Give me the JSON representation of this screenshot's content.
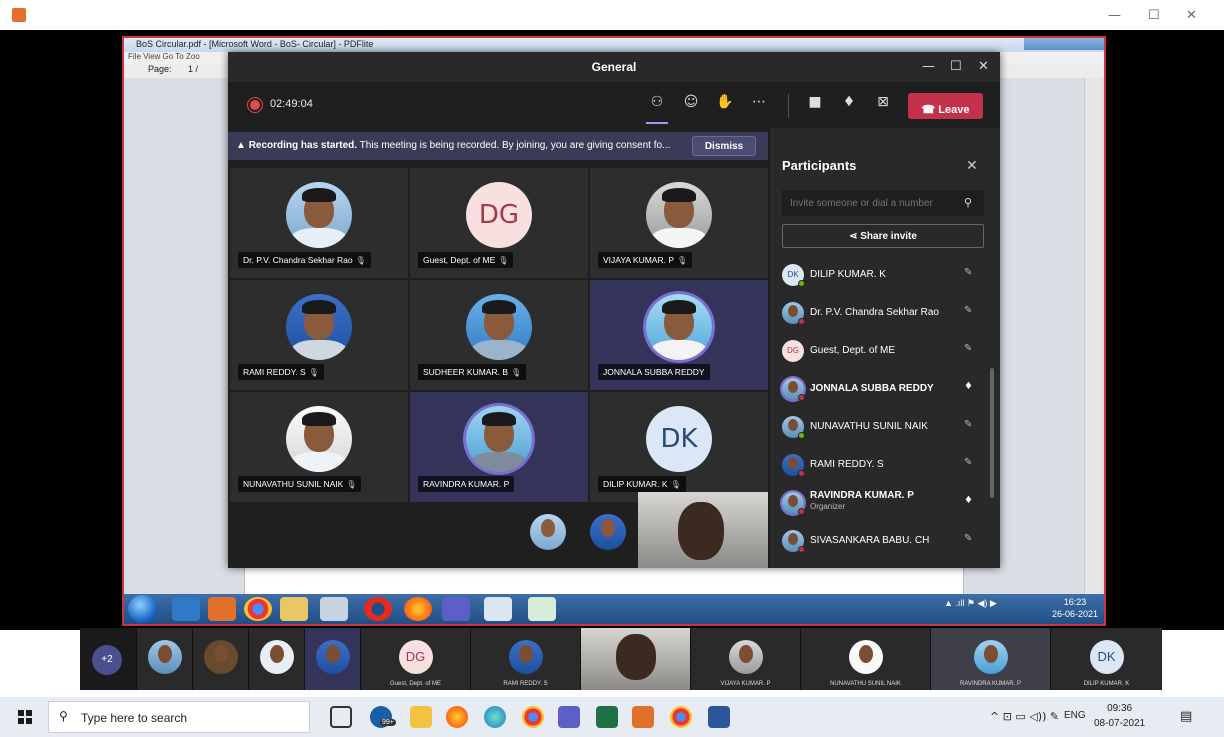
{
  "outer_window": {
    "minimize": "—",
    "maximize": "☐",
    "close": "✕"
  },
  "pdf": {
    "title": "BoS Circular.pdf - [Microsoft Word - BoS- Circular] - PDFlite",
    "menu": "File   View   Go To   Zoo",
    "page_label": "Page:",
    "page_value": "1 /"
  },
  "win7": {
    "tray": "▲ .ıll  ⚑  ◀)  ▶",
    "time": "16:23",
    "date": "26-06-2021"
  },
  "teams": {
    "title": "General",
    "timer": "02:49:04",
    "leave_label": "Leave",
    "banner_bold": "Recording has started.",
    "banner_text": "This meeting is being recorded. By joining, you are giving consent fo...",
    "dismiss_label": "Dismiss",
    "tiles": [
      {
        "name": "Dr. P.V. Chandra Sekhar Rao"
      },
      {
        "name": "Guest, Dept. of ME",
        "initials": "DG"
      },
      {
        "name": "VIJAYA KUMAR. P"
      },
      {
        "name": "RAMI REDDY. S"
      },
      {
        "name": "SUDHEER KUMAR. B"
      },
      {
        "name": "JONNALA SUBBA REDDY"
      },
      {
        "name": "NUNAVATHU SUNIL NAIK"
      },
      {
        "name": "RAVINDRA KUMAR. P"
      },
      {
        "name": "DILIP KUMAR. K",
        "initials": "DK"
      }
    ],
    "panel": {
      "title": "Participants",
      "invite_placeholder": "Invite someone or dial a number",
      "share_invite": "Share invite",
      "participants": [
        {
          "name": "DILIP KUMAR. K",
          "initials": "DK",
          "mic": "muted"
        },
        {
          "name": "Dr. P.V. Chandra Sekhar Rao",
          "mic": "muted"
        },
        {
          "name": "Guest, Dept. of ME",
          "initials": "DG",
          "mic": "muted"
        },
        {
          "name": "JONNALA SUBBA REDDY",
          "mic": "on"
        },
        {
          "name": "NUNAVATHU SUNIL NAIK",
          "mic": "muted"
        },
        {
          "name": "RAMI REDDY. S",
          "mic": "muted"
        },
        {
          "name": "RAVINDRA KUMAR. P",
          "sub": "Organizer",
          "mic": "on"
        },
        {
          "name": "SIVASANKARA BABU. CH",
          "mic": "muted"
        }
      ]
    }
  },
  "strip": {
    "more": "+2",
    "thumbs": [
      {
        "name": ""
      },
      {
        "name": ""
      },
      {
        "name": ""
      },
      {
        "name": ""
      },
      {
        "name": "Guest, Dept. of ME",
        "initials": "DG"
      },
      {
        "name": "RAMI REDDY. S"
      },
      {
        "name": ""
      },
      {
        "name": "VIJAYA KUMAR. P"
      },
      {
        "name": "NUNAVATHU SUNIL NAIK"
      },
      {
        "name": "RAVINDRA KUMAR. P"
      },
      {
        "name": "DILIP KUMAR. K",
        "initials": "DK"
      }
    ]
  },
  "taskbar": {
    "search_placeholder": "Type here to search",
    "badge": "99+",
    "tray": "^ ⊡ ▭ ◁)) ✎",
    "lang": "ENG",
    "time": "09:36",
    "date": "08-07-2021"
  }
}
